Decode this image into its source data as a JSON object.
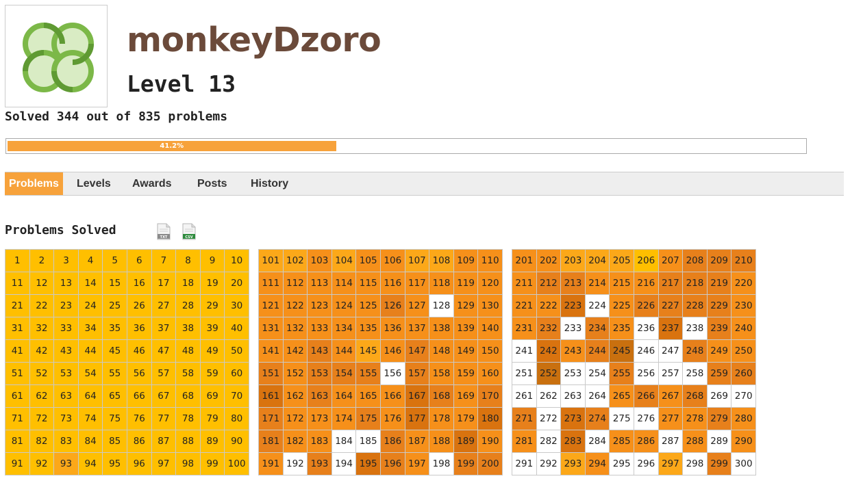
{
  "profile": {
    "username": "monkeyDzoro",
    "level": "Level 13",
    "solved_text": "Solved 344 out of 835 problems",
    "progress_fraction": 0.412,
    "progress_label": "41.2%",
    "avatar_icon": "clover-logo-icon"
  },
  "tabs": [
    {
      "label": "Problems",
      "active": true
    },
    {
      "label": "Levels",
      "active": false
    },
    {
      "label": "Awards",
      "active": false
    },
    {
      "label": "Posts",
      "active": false
    },
    {
      "label": "History",
      "active": false
    }
  ],
  "problems_section": {
    "title": "Problems Solved",
    "downloads": [
      {
        "label": "TXT",
        "icon": "txt-file-icon",
        "color": "#888888"
      },
      {
        "label": "CSV",
        "icon": "csv-file-icon",
        "color": "#2e8b3d"
      }
    ]
  },
  "colors": {
    "accent": "#f7a23b",
    "levels": [
      "#ffffff",
      "#ffbf00",
      "#fca819",
      "#f6901a",
      "#e7801b",
      "#d9730f",
      "#c9700f"
    ]
  },
  "legend": "Each number cell is a problem; fill shade encodes how many users solved it (0 = unsolved/white, 6 = darkest).",
  "grids": [
    {
      "start": 1,
      "levels": [
        1,
        1,
        1,
        1,
        1,
        1,
        1,
        1,
        1,
        1,
        1,
        1,
        1,
        1,
        1,
        1,
        1,
        1,
        1,
        1,
        1,
        1,
        1,
        1,
        1,
        1,
        1,
        1,
        1,
        1,
        1,
        1,
        1,
        1,
        1,
        1,
        1,
        1,
        1,
        1,
        1,
        1,
        1,
        1,
        1,
        1,
        1,
        1,
        1,
        1,
        1,
        1,
        1,
        1,
        1,
        1,
        1,
        1,
        1,
        1,
        1,
        1,
        1,
        1,
        1,
        1,
        1,
        1,
        1,
        1,
        1,
        1,
        1,
        1,
        1,
        1,
        1,
        1,
        1,
        1,
        1,
        1,
        1,
        1,
        1,
        1,
        1,
        1,
        1,
        1,
        1,
        1,
        2,
        1,
        1,
        1,
        1,
        1,
        1,
        1
      ]
    },
    {
      "start": 101,
      "levels": [
        2,
        2,
        3,
        2,
        3,
        3,
        2,
        2,
        3,
        3,
        3,
        3,
        3,
        3,
        3,
        3,
        3,
        3,
        3,
        3,
        3,
        3,
        3,
        3,
        3,
        4,
        3,
        0,
        3,
        3,
        3,
        3,
        3,
        3,
        3,
        3,
        3,
        3,
        3,
        3,
        3,
        3,
        4,
        3,
        2,
        3,
        4,
        3,
        3,
        3,
        4,
        3,
        4,
        4,
        4,
        0,
        4,
        3,
        3,
        3,
        5,
        3,
        4,
        3,
        3,
        3,
        5,
        4,
        3,
        4,
        4,
        3,
        3,
        3,
        4,
        3,
        5,
        3,
        3,
        5,
        4,
        3,
        3,
        0,
        0,
        4,
        3,
        3,
        5,
        3,
        3,
        0,
        4,
        0,
        5,
        4,
        3,
        0,
        4,
        4
      ]
    },
    {
      "start": 201,
      "levels": [
        3,
        3,
        2,
        2,
        2,
        1,
        3,
        4,
        4,
        4,
        3,
        4,
        4,
        3,
        3,
        3,
        4,
        4,
        4,
        3,
        3,
        3,
        5,
        0,
        3,
        4,
        4,
        4,
        4,
        3,
        3,
        4,
        0,
        4,
        3,
        0,
        5,
        0,
        4,
        3,
        0,
        5,
        3,
        4,
        6,
        0,
        0,
        4,
        3,
        3,
        0,
        6,
        0,
        0,
        4,
        0,
        0,
        0,
        4,
        4,
        0,
        0,
        0,
        0,
        3,
        4,
        3,
        4,
        0,
        0,
        4,
        0,
        5,
        4,
        0,
        0,
        3,
        3,
        4,
        3,
        3,
        0,
        5,
        0,
        3,
        3,
        0,
        3,
        0,
        3,
        0,
        0,
        2,
        3,
        0,
        0,
        2,
        0,
        4,
        0
      ]
    }
  ]
}
